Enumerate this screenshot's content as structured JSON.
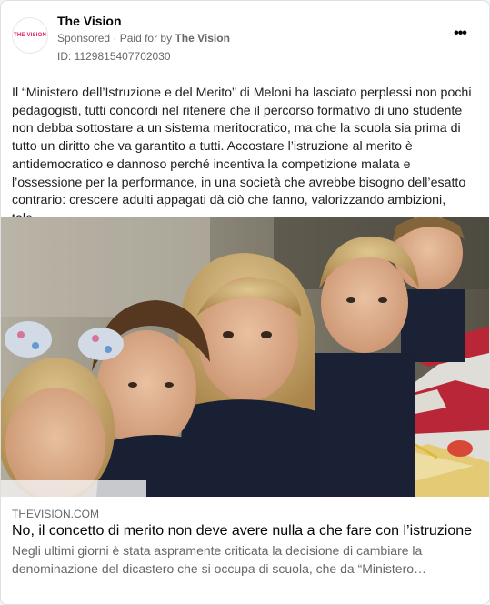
{
  "post": {
    "page_name": "The Vision",
    "avatar_text": "THE VISION",
    "sponsored_label": "Sponsored",
    "separator": "·",
    "paid_for_prefix": "Paid for by",
    "paid_for_name": "The Vision",
    "ad_id": "ID: 1129815407702030",
    "more_icon": "more-horizontal-icon",
    "body_text": "Il “Ministero dell’Istruzione e del Merito” di Meloni ha lasciato perplessi non pochi pedagogisti, tutti concordi nel ritenere che il percorso formativo di uno studente non debba sottostare a un sistema meritocratico, ma che la scuola sia prima di tutto un diritto che va garantito a tutti. Accostare l’istruzione al merito è antidemocratico e dannoso perché incentiva la competizione malata e l’ossessione per la performance, in una società che avrebbe bisogno dell’esatto contrario: crescere adulti appagati dà ciò che fanno, valorizzando ambizioni, tale…"
  },
  "link": {
    "domain": "THEVISION.COM",
    "headline": "No, il concetto di merito non deve avere nulla a che fare con l’istruzione",
    "description": "Negli ultimi giorni è stata aspramente criticata la decisione di cambiare la denominazione del dicastero che si occupa di scuola, che da “Ministero…"
  },
  "colors": {
    "brand": "#e0245e",
    "secondary_text": "#65676b",
    "card_border": "#dddfe2"
  }
}
